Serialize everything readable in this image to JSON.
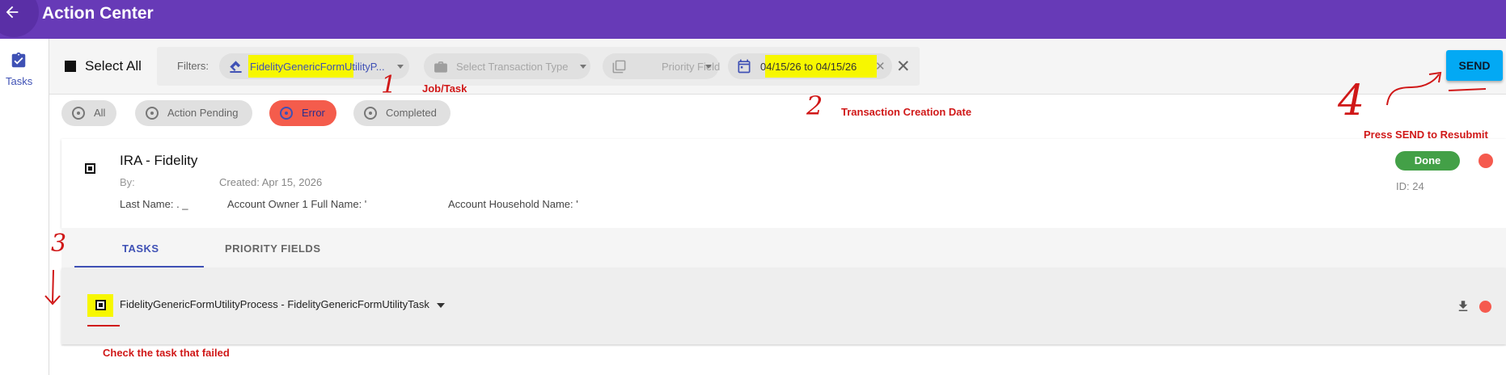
{
  "header": {
    "title": "Action Center"
  },
  "sidebar": {
    "tasks_label": "Tasks"
  },
  "toolbar": {
    "select_all_label": "Select All",
    "filters_label": "Filters:",
    "job_filter_value": "FidelityGenericFormUtilityP...",
    "transaction_type_placeholder": "Select Transaction Type",
    "priority_field_placeholder": "Priority Field",
    "date_range": "04/15/26 to 04/15/26",
    "send_label": "SEND"
  },
  "status_filters": [
    {
      "label": "All",
      "active": false
    },
    {
      "label": "Action Pending",
      "active": false
    },
    {
      "label": "Error",
      "active": true
    },
    {
      "label": "Completed",
      "active": false
    }
  ],
  "annotations": {
    "num1": "1",
    "job_task": "Job/Task",
    "num2": "2",
    "transaction_creation_date": "Transaction Creation Date",
    "num3": "3",
    "num4": "4",
    "press_send": "Press SEND to Resubmit",
    "check_task": "Check the task that failed"
  },
  "card": {
    "title": "IRA - Fidelity",
    "by_label": "By:",
    "created": "Created: Apr 15, 2026",
    "last_name_label": "Last Name: . _",
    "account_owner_label": "Account Owner 1 Full Name: '",
    "account_household_label": "Account Household Name: '",
    "status": "Done",
    "id": "ID: 24"
  },
  "tabs": [
    {
      "label": "TASKS",
      "active": true
    },
    {
      "label": "PRIORITY FIELDS",
      "active": false
    }
  ],
  "task": {
    "name": "FidelityGenericFormUtilityProcess - FidelityGenericFormUtilityTask"
  },
  "colors": {
    "topbar": "#673ab7",
    "accent": "#3f51b5",
    "send": "#03a9f4",
    "error": "#f45c4c",
    "done": "#43a047",
    "highlight": "#f7f700",
    "annotation": "#d01818"
  }
}
